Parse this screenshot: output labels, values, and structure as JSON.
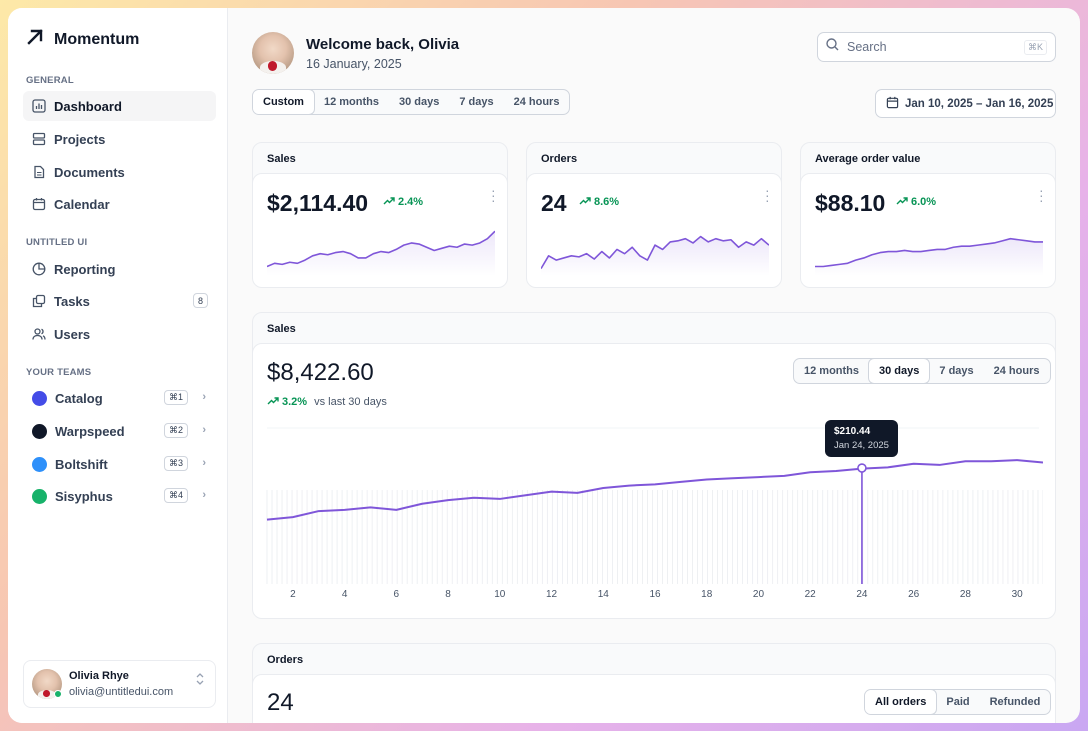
{
  "app": {
    "name": "Momentum"
  },
  "sidebar": {
    "general_label": "GENERAL",
    "general_items": [
      {
        "label": "Dashboard",
        "icon": "bar-chart-icon",
        "active": true
      },
      {
        "label": "Projects",
        "icon": "layers-icon"
      },
      {
        "label": "Documents",
        "icon": "file-icon"
      },
      {
        "label": "Calendar",
        "icon": "calendar-icon"
      }
    ],
    "untitled_label": "UNTITLED UI",
    "untitled_items": [
      {
        "label": "Reporting",
        "icon": "pie-chart-icon"
      },
      {
        "label": "Tasks",
        "icon": "copy-icon",
        "badge": "8"
      },
      {
        "label": "Users",
        "icon": "users-icon"
      }
    ],
    "teams_label": "YOUR TEAMS",
    "teams": [
      {
        "label": "Catalog",
        "shortcut": "⌘1",
        "color": "#444ce7"
      },
      {
        "label": "Warpspeed",
        "shortcut": "⌘2",
        "color": "#101828"
      },
      {
        "label": "Boltshift",
        "shortcut": "⌘3",
        "color": "#2e90fa"
      },
      {
        "label": "Sisyphus",
        "shortcut": "⌘4",
        "color": "#17b26a"
      }
    ],
    "user": {
      "name": "Olivia Rhye",
      "email": "olivia@untitledui.com"
    }
  },
  "header": {
    "welcome": "Welcome back, Olivia",
    "date": "16 January, 2025",
    "search_placeholder": "Search",
    "search_shortcut": "⌘K",
    "ranges": [
      "Custom",
      "12 months",
      "30 days",
      "7 days",
      "24 hours"
    ],
    "active_range": "Custom",
    "date_range": "Jan 10, 2025 – Jan 16, 2025"
  },
  "stat_cards": [
    {
      "title": "Sales",
      "value": "$2,114.40",
      "change": "2.4%",
      "spark": [
        12,
        15,
        14,
        16,
        15,
        18,
        22,
        24,
        23,
        25,
        26,
        24,
        20,
        20,
        24,
        26,
        25,
        28,
        32,
        34,
        33,
        30,
        27,
        29,
        31,
        30,
        33,
        32,
        34,
        38,
        45
      ]
    },
    {
      "title": "Orders",
      "value": "24",
      "change": "8.6%",
      "spark": [
        10,
        22,
        18,
        20,
        22,
        21,
        24,
        19,
        26,
        20,
        28,
        24,
        30,
        22,
        18,
        32,
        28,
        35,
        36,
        38,
        34,
        40,
        35,
        38,
        36,
        37,
        30,
        35,
        32,
        38,
        32
      ]
    },
    {
      "title": "Average order value",
      "value": "$88.10",
      "change": "6.0%",
      "spark": [
        12,
        12,
        13,
        14,
        15,
        18,
        20,
        23,
        25,
        26,
        26,
        27,
        26,
        26,
        27,
        28,
        28,
        30,
        31,
        31,
        32,
        33,
        34,
        36,
        38,
        37,
        36,
        35,
        35
      ]
    }
  ],
  "sales_panel": {
    "header": "Sales",
    "value": "$8,422.60",
    "change": "3.2%",
    "change_suffix": "vs last 30 days",
    "ranges": [
      "12 months",
      "30 days",
      "7 days",
      "24 hours"
    ],
    "active_range": "30 days",
    "tooltip": {
      "value": "$210.44",
      "date": "Jan 24, 2025"
    }
  },
  "orders_panel": {
    "header": "Orders",
    "value": "24",
    "filters": [
      "All orders",
      "Paid",
      "Refunded"
    ],
    "active_filter": "All orders"
  },
  "chart_data": {
    "type": "line",
    "x": [
      1,
      2,
      3,
      4,
      5,
      6,
      7,
      8,
      9,
      10,
      11,
      12,
      13,
      14,
      15,
      16,
      17,
      18,
      19,
      20,
      21,
      22,
      23,
      24,
      25,
      26,
      27,
      28,
      29,
      30,
      31
    ],
    "x_ticks": [
      2,
      4,
      6,
      8,
      10,
      12,
      14,
      16,
      18,
      20,
      22,
      24,
      26,
      28,
      30
    ],
    "series": [
      {
        "values": [
          168,
          170,
          175,
          176,
          178,
          176,
          181,
          184,
          186,
          185,
          188,
          191,
          190,
          194,
          196,
          197,
          199,
          201,
          202,
          203,
          204,
          207,
          208,
          210,
          211,
          214,
          213,
          216,
          216,
          217,
          215
        ]
      }
    ],
    "highlight": {
      "x": 24,
      "y": 210.44
    },
    "color": "#7f56d9",
    "grid": true
  }
}
